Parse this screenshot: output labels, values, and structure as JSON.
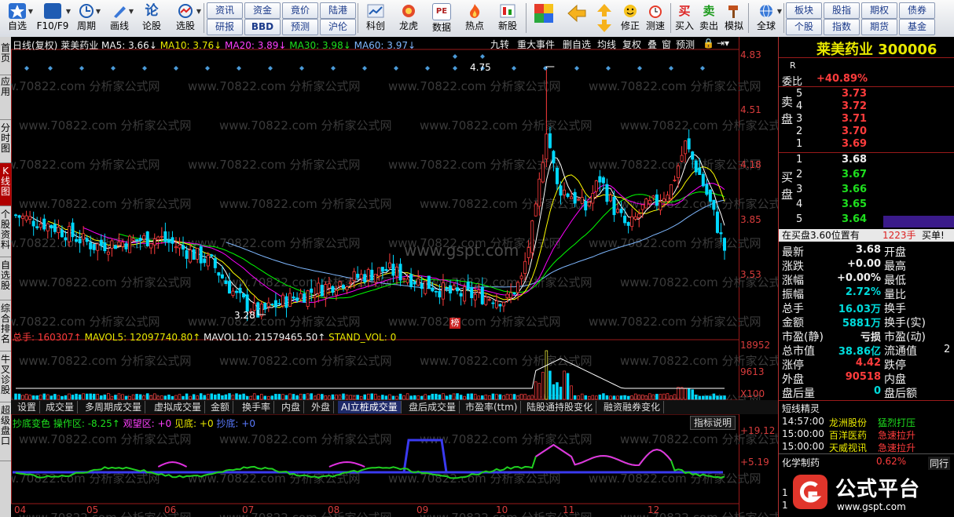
{
  "toolbar": {
    "items": [
      {
        "label": "自选",
        "icon": "star-icon"
      },
      {
        "label": "F10/F9",
        "icon": "f10-icon"
      },
      {
        "label": "周期",
        "icon": "clock-icon"
      },
      {
        "label": "画线",
        "icon": "pen-icon"
      },
      {
        "label": "论股",
        "icon": "discuss-icon"
      },
      {
        "label": "选股",
        "icon": "radar-icon"
      }
    ],
    "grid_buttons": [
      "资讯",
      "资金",
      "竟价",
      "陆港",
      "研报",
      "BBD",
      "预测",
      "沪伦"
    ],
    "items2": [
      {
        "label": "科创",
        "icon": "kechuang-icon"
      },
      {
        "label": "龙虎",
        "icon": "dragon-tiger-icon"
      },
      {
        "label": "数据",
        "icon": "data-pe-icon"
      },
      {
        "label": "热点",
        "icon": "hot-icon"
      },
      {
        "label": "新股",
        "icon": "new-stock-icon"
      }
    ],
    "items3": [
      {
        "label": "",
        "icon": "color-grid-icon"
      },
      {
        "label": "",
        "icon": "back-arrow-icon"
      },
      {
        "label": "",
        "icon": "updown-arrow-icon"
      },
      {
        "label": "修正",
        "icon": "smile-icon"
      },
      {
        "label": "测速",
        "icon": "alarm-clock-icon"
      },
      {
        "label": "买入",
        "icon": "buy-icon"
      },
      {
        "label": "卖出",
        "icon": "sell-icon"
      },
      {
        "label": "模拟",
        "icon": "hammer-icon"
      },
      {
        "label": "全球",
        "icon": "globe-icon"
      }
    ],
    "grid_buttons2": [
      "板块",
      "股指",
      "期权",
      "债券",
      "个股",
      "指数",
      "期货",
      "基金"
    ]
  },
  "leftnav": [
    "首页",
    "应用",
    "分时图",
    "K线图",
    "个股资料",
    "自选股",
    "综合排名",
    "牛叉诊股",
    "超级盘口"
  ],
  "chart_header": {
    "period": "日线(复权)",
    "name": "莱美药业",
    "ma5": "MA5: 3.66↓",
    "ma10": "MA10: 3.76↓",
    "ma20": "MA20: 3.89↓",
    "ma30": "MA30: 3.98↓",
    "ma60": "MA60: 3.97↓",
    "buttons": [
      "九转",
      "重大事件",
      "删自选",
      "均线",
      "复权",
      "叠",
      "窗",
      "预测"
    ]
  },
  "price_axis": [
    "4.83",
    "4.51",
    "4.18",
    "3.85",
    "3.53"
  ],
  "annotations": {
    "high": "4.75",
    "low": "3.28",
    "flag": "榜",
    "watermark": "www.gspt.com",
    "watermark2": "www.70822.com 分析家公式网"
  },
  "volume_header": {
    "total": "总手: 160307↑",
    "mavol5": "MAVOL5: 12097740.80↑",
    "mavol10": "MAVOL10: 21579465.50↑",
    "stand": "STAND_VOL: 0"
  },
  "volume_axis": [
    "18952",
    "9613",
    "X100"
  ],
  "tabs": [
    "设置",
    "成交量",
    "多周期成交量",
    "虚拟成交量",
    "金额",
    "换手率",
    "内盘",
    "外盘",
    "AI立桩成交量",
    "盘后成交量",
    "市盈率(ttm)",
    "陆股通持股变化",
    "融资融券变化"
  ],
  "indicator_header": {
    "name": "抄底变色",
    "op": "操作区: -8.25↑",
    "watch": "观望区: +0",
    "seen": "见底: +0",
    "bottom": "抄底: +0",
    "button": "指标说明"
  },
  "indicator_axis": [
    "+19.12",
    "+5.19"
  ],
  "months": [
    "04",
    "05",
    "06",
    "07",
    "08",
    "09",
    "10",
    "11",
    "12"
  ],
  "stock": {
    "name": "莱美药业",
    "code": "300006",
    "badge": "R"
  },
  "order_book": {
    "wei_label": "委比",
    "wei_value": "+40.89%",
    "sell_label": "卖盘",
    "buy_label": "买盘",
    "sells": [
      {
        "lvl": "5",
        "price": "3.73"
      },
      {
        "lvl": "4",
        "price": "3.72"
      },
      {
        "lvl": "3",
        "price": "3.71"
      },
      {
        "lvl": "2",
        "price": "3.70"
      },
      {
        "lvl": "1",
        "price": "3.69"
      }
    ],
    "buys": [
      {
        "lvl": "1",
        "price": "3.68"
      },
      {
        "lvl": "2",
        "price": "3.67"
      },
      {
        "lvl": "3",
        "price": "3.66"
      },
      {
        "lvl": "4",
        "price": "3.65"
      },
      {
        "lvl": "5",
        "price": "3.64"
      }
    ],
    "notice": "在买盘3.60位置有",
    "notice_qty": "1223手",
    "notice_tag": "买单!"
  },
  "quotes": [
    {
      "l": "最新",
      "v": "3.68",
      "r": "开盘"
    },
    {
      "l": "涨跌",
      "v": "+0.00",
      "r": "最高"
    },
    {
      "l": "涨幅",
      "v": "+0.00%",
      "r": "最低"
    },
    {
      "l": "振幅",
      "v": "2.72%",
      "r": "量比"
    },
    {
      "l": "总手",
      "v": "16.03万",
      "r": "换手"
    },
    {
      "l": "金额",
      "v": "5881万",
      "r": "换手(实)"
    },
    {
      "l": "市盈(静)",
      "v": "亏损",
      "r": "市盈(动)"
    },
    {
      "l": "总市值",
      "v": "38.86亿",
      "r": "流通值"
    },
    {
      "l": "涨停",
      "v": "4.42",
      "r": "跌停"
    },
    {
      "l": "外盘",
      "v": "90518",
      "r": "内盘"
    },
    {
      "l": "盘后量",
      "v": "0",
      "r": "盘后额"
    }
  ],
  "quotes_extra": {
    "liutong_tail": "2"
  },
  "short_line": {
    "title": "短线精灵",
    "rows": [
      {
        "t": "14:57:00",
        "n": "龙洲股份",
        "e": "猛烈打压"
      },
      {
        "t": "15:00:00",
        "n": "百洋医药",
        "e": "急速拉升"
      },
      {
        "t": "15:00:00",
        "n": "天威视讯",
        "e": "急速拉升"
      }
    ]
  },
  "sector": {
    "name": "化学制药",
    "pct": "0.62%",
    "tag": "同行"
  },
  "brand": {
    "name": "公式平台",
    "url": "www.gspt.com"
  },
  "colors": {
    "up": "#ff3c3c",
    "down": "#00d8ff",
    "ma5": "#ffffff",
    "ma10": "#ffff00",
    "ma20": "#ff00ff",
    "ma30": "#00ff00",
    "ma60": "#7fb8ff"
  }
}
